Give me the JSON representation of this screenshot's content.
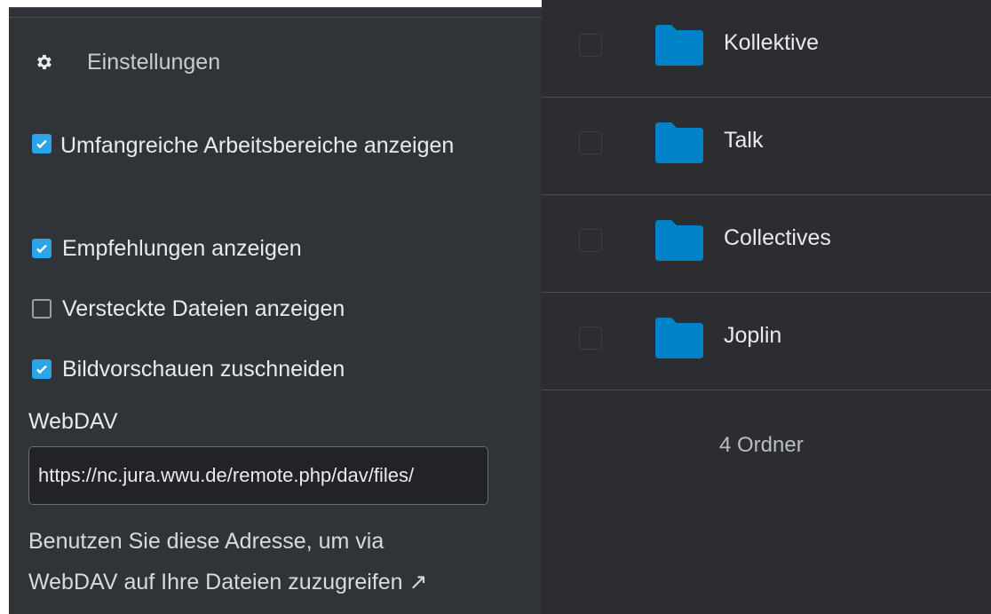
{
  "sidebar": {
    "settings_label": "Einstellungen",
    "options": [
      {
        "label": "Umfangreiche Arbeitsbereiche anzeigen",
        "checked": true
      },
      {
        "label": "Empfehlungen anzeigen",
        "checked": true
      },
      {
        "label": "Versteckte Dateien anzeigen",
        "checked": false
      },
      {
        "label": "Bildvorschauen zuschneiden",
        "checked": true
      }
    ],
    "webdav": {
      "label": "WebDAV",
      "url": "https://nc.jura.wwu.de/remote.php/dav/files/",
      "help_line1": "Benutzen Sie diese Adresse, um via",
      "help_line2": "WebDAV auf Ihre Dateien zuzugreifen ↗"
    }
  },
  "files": {
    "rows": [
      {
        "name": "Kollektive"
      },
      {
        "name": "Talk"
      },
      {
        "name": "Collectives"
      },
      {
        "name": "Joplin"
      }
    ],
    "summary": "4 Ordner"
  },
  "colors": {
    "accent": "#2ba5e8",
    "folder": "#0082c9",
    "sidebar_bg": "#303338",
    "content_bg": "#2b2d31"
  }
}
